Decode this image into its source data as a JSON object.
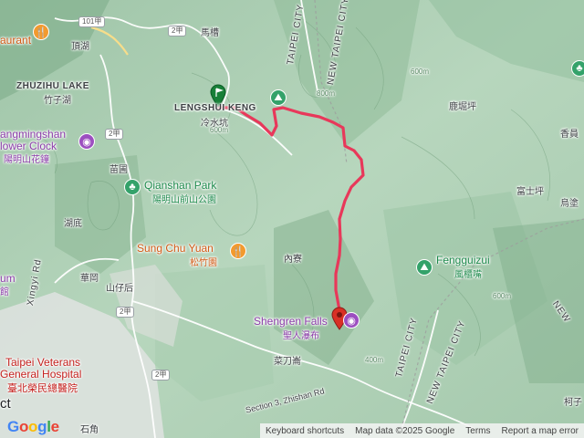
{
  "map": {
    "route_color": "#e8385a",
    "labels": {
      "maccao": "馬槽",
      "dinghu": "頂湖",
      "zhuzihu_lake": "ZHUZIHU LAKE",
      "zhuzihu_cn": "竹子湖",
      "restaurant_partial": "aurant",
      "yangmingshan_partial": "angmingshan",
      "flower_clock_partial": "lower Clock",
      "yms_flower_clock_cn": "陽明山花鐘",
      "miaopu": "苗圃",
      "qianshan_park": "Qianshan Park",
      "qianshan_park_cn": "陽明山前山公園",
      "hudi": "湖底",
      "sung_chu_yuan": "Sung Chu Yuan",
      "sung_chu_yuan_cn": "松竹園",
      "neiliao": "內寮",
      "huagang": "華岡",
      "shanzihou": "山仔后",
      "xingyi_rd": "Xingyi Rd",
      "um_partial": "um",
      "guan_partial": "館",
      "lengshui_keng": "LENGSHUI KENG",
      "lengshui_keng_cn": "冷水坑",
      "shengren_falls": "Shengren Falls",
      "shengren_falls_cn": "聖人瀑布",
      "caidaolun": "菜刀崙",
      "zhishan_rd": "Section 3, Zhishan Rd",
      "luku_ping": "鹿堀坪",
      "xiang_partial": "香員",
      "fushi_ping": "富士坪",
      "wu_partial": "烏塗",
      "fengguizui": "Fengguizui",
      "fengguizui_cn": "風櫃嘴",
      "taipei_city_top": "TAIPEI CITY",
      "new_taipei_city_top": "NEW TAIPEI CITY",
      "taipei_city_bottom": "TAIPEI CITY",
      "new_taipei_city_bottom": "NEW TAIPEI CITY",
      "new_partial": "NEW",
      "taipei_veterans": "Taipei Veterans",
      "general_hospital": "General Hospital",
      "veterans_cn": "臺北榮民總醫院",
      "ct_partial": "ct",
      "shijiao": "石角",
      "kezi_partial": "柯子"
    },
    "shields": {
      "r101": "101甲",
      "r2jia_top": "2甲",
      "r2_left": "2甲",
      "r2_mid": "2甲",
      "r2_bottom": "2甲"
    },
    "elevations": {
      "e800a": "800m",
      "e600a": "600m",
      "e600b": "600m",
      "e600c": "600m",
      "e400a": "400m"
    },
    "icons": {
      "start_marker": "green-flag-pin",
      "end_marker": "red-pin",
      "restaurant": "restaurant-icon",
      "museum": "camera-icon",
      "park": "tree-icon",
      "hiking": "hiking-icon"
    }
  },
  "attribution": {
    "logo": [
      "G",
      "o",
      "o",
      "g",
      "l",
      "e"
    ],
    "keyboard": "Keyboard shortcuts",
    "mapdata": "Map data ©2025 Google",
    "terms": "Terms",
    "report": "Report a map error"
  }
}
